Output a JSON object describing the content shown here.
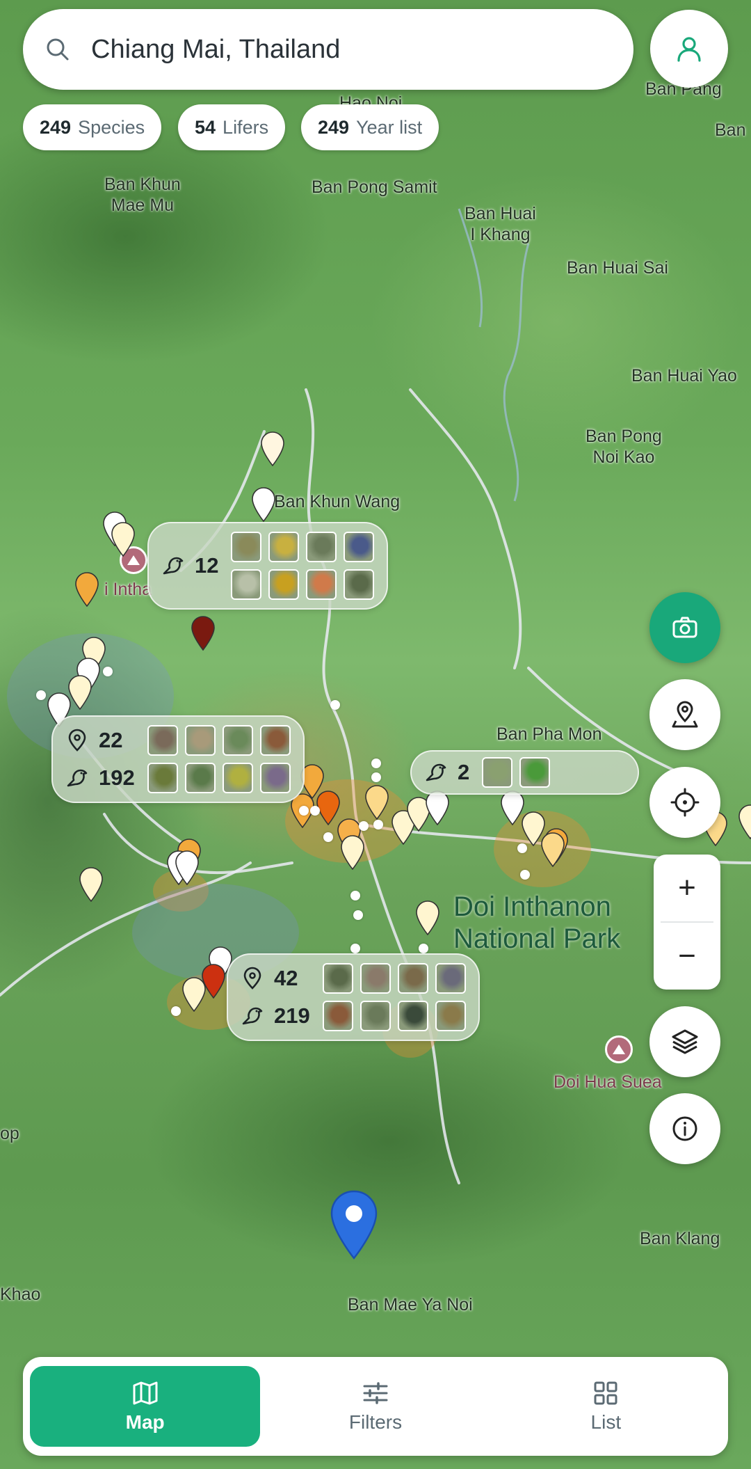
{
  "search": {
    "value": "Chiang Mai, Thailand"
  },
  "chips": [
    {
      "num": "249",
      "label": "Species"
    },
    {
      "num": "54",
      "label": "Lifers"
    },
    {
      "num": "249",
      "label": "Year list"
    }
  ],
  "places": {
    "ban_khun_mae_mu": "Ban Khun\nMae Mu",
    "ban_pong_samit": "Ban Pong Samit",
    "ban_huai_i_khang": "Ban Huai\nI Khang",
    "ban_huai_sai": "Ban Huai Sai",
    "ban_huai_yao": "Ban Huai Yao",
    "ban_pong_noi_kao": "Ban Pong\nNoi Kao",
    "ban_khun_wang": "Ban Khun Wang",
    "ban_pha_mon": "Ban Pha Mon",
    "doi_inthanon": "Doi Inthanon\nNational Park",
    "doi_hua_suea": "Doi Hua Suea",
    "ban_klang": "Ban Klang",
    "ban_mae_ya_noi": "Ban Mae Ya Noi",
    "ban_pang": "Ban Pang",
    "hao_noi": "Hao Noi",
    "inthanon_short": "i Intha",
    "op": "op",
    "khao": "Khao",
    "ban_edge": "Ban"
  },
  "clusters": [
    {
      "birds": "12",
      "thumbs": [
        "#8a8a5a",
        "#c8b040",
        "#6a7a5a",
        "#4a5a8a",
        "#b8c0a8",
        "#c8a020",
        "#d07a4a",
        "#5a6a4a"
      ]
    },
    {
      "locations": "22",
      "birds": "192",
      "thumbs": [
        "#7a6a5a",
        "#a89a7a",
        "#6a8a5a",
        "#8a5a3a",
        "#6a7a3a",
        "#5a7a4a",
        "#b0b040",
        "#7a6a8a"
      ]
    },
    {
      "birds": "2",
      "thumbs": [
        "#8aa070",
        "#4a9a3a"
      ]
    },
    {
      "locations": "42",
      "birds": "219",
      "thumbs": [
        "#5a6a4a",
        "#8a7a6a",
        "#7a6a4a",
        "#6a6a7a",
        "#8a5a3a",
        "#6a7a5a",
        "#3a4a3a",
        "#8a7a4a"
      ]
    }
  ],
  "zoom": {
    "in": "+",
    "out": "−"
  },
  "nav": [
    {
      "label": "Map",
      "icon": "map-icon"
    },
    {
      "label": "Filters",
      "icon": "sliders-icon"
    },
    {
      "label": "List",
      "icon": "grid-icon"
    }
  ],
  "colors": {
    "accent": "#19b07e",
    "location_pin": "#2b6fe0"
  }
}
